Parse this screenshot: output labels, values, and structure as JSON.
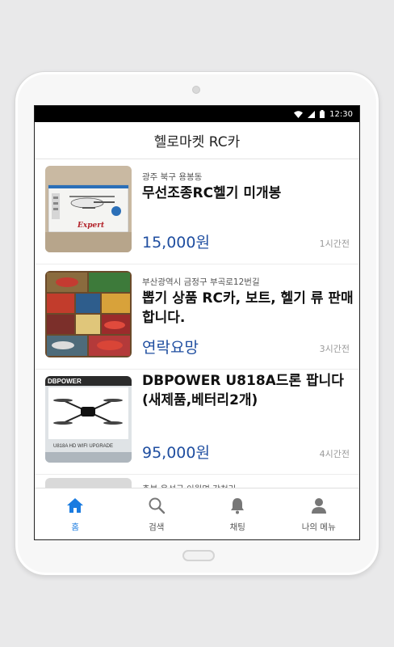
{
  "status": {
    "time": "12:30"
  },
  "header": {
    "title": "헬로마켓 RC카"
  },
  "listings": [
    {
      "location": "광주 북구 용봉동",
      "title": "무선조종RC헬기 미개봉",
      "price": "15,000원",
      "time": "1시간전"
    },
    {
      "location": "부산광역시 금정구 부곡로12번길",
      "title": "뽑기 상품 RC카, 보트, 헬기 류 판매합니다.",
      "price": "연락요망",
      "time": "3시간전"
    },
    {
      "location": "",
      "title": "DBPOWER U818A드론 팝니다 (새제품,베터리2개)",
      "price": "95,000원",
      "time": "4시간전"
    },
    {
      "location": "충북 음성군 이월면 각천리",
      "title": "",
      "price": "",
      "time": ""
    }
  ],
  "thumbs": {
    "heli_brand": "Expert",
    "drone_brand": "DBPOWER",
    "drone_text": "U818A HD WIFI UPGRADE"
  },
  "tabs": [
    {
      "label": "홈",
      "icon": "home-icon"
    },
    {
      "label": "검색",
      "icon": "search-icon"
    },
    {
      "label": "채팅",
      "icon": "bell-icon"
    },
    {
      "label": "나의 메뉴",
      "icon": "person-icon"
    }
  ],
  "colors": {
    "accent": "#1a7be0",
    "price": "#1f4ea0"
  }
}
